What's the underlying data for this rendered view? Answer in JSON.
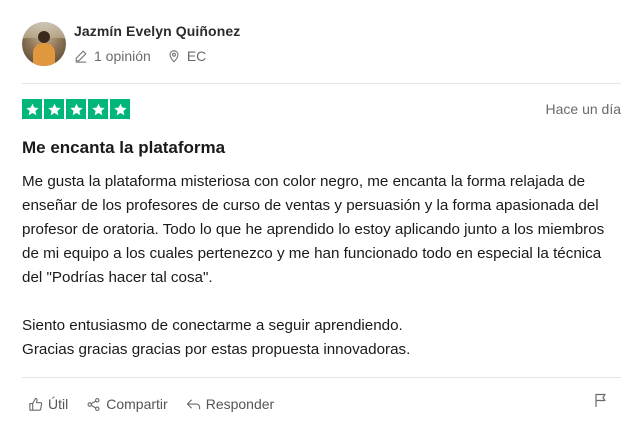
{
  "user": {
    "name": "Jazmín Evelyn Quiñonez",
    "reviews": "1 opinión",
    "country": "EC"
  },
  "review": {
    "rating": 5,
    "date": "Hace un día",
    "title": "Me encanta la plataforma",
    "paragraphs": [
      "Me gusta la plataforma misteriosa con color negro, me encanta la forma relajada de enseñar de los profesores de curso de ventas y persuasión y la forma apasionada del profesor de oratoria. Todo lo que he aprendido lo estoy aplicando junto a los miembros de mi equipo a los cuales pertenezco y me han funcionado todo en especial la técnica del \"Podrías hacer tal cosa\".",
      "Siento entusiasmo de conectarme a seguir aprendiendo.\nGracias gracias gracias por estas propuesta innovadoras."
    ]
  },
  "actions": {
    "useful": "Útil",
    "share": "Compartir",
    "reply": "Responder"
  },
  "icons": {
    "reviews": "pencil-icon",
    "country": "location-pin-icon",
    "useful": "thumbs-up-icon",
    "share": "share-icon",
    "reply": "reply-icon",
    "report": "flag-icon",
    "rating": "star-icon"
  },
  "colors": {
    "star_green": "#00b67a",
    "muted_text": "#6b6b6b"
  }
}
